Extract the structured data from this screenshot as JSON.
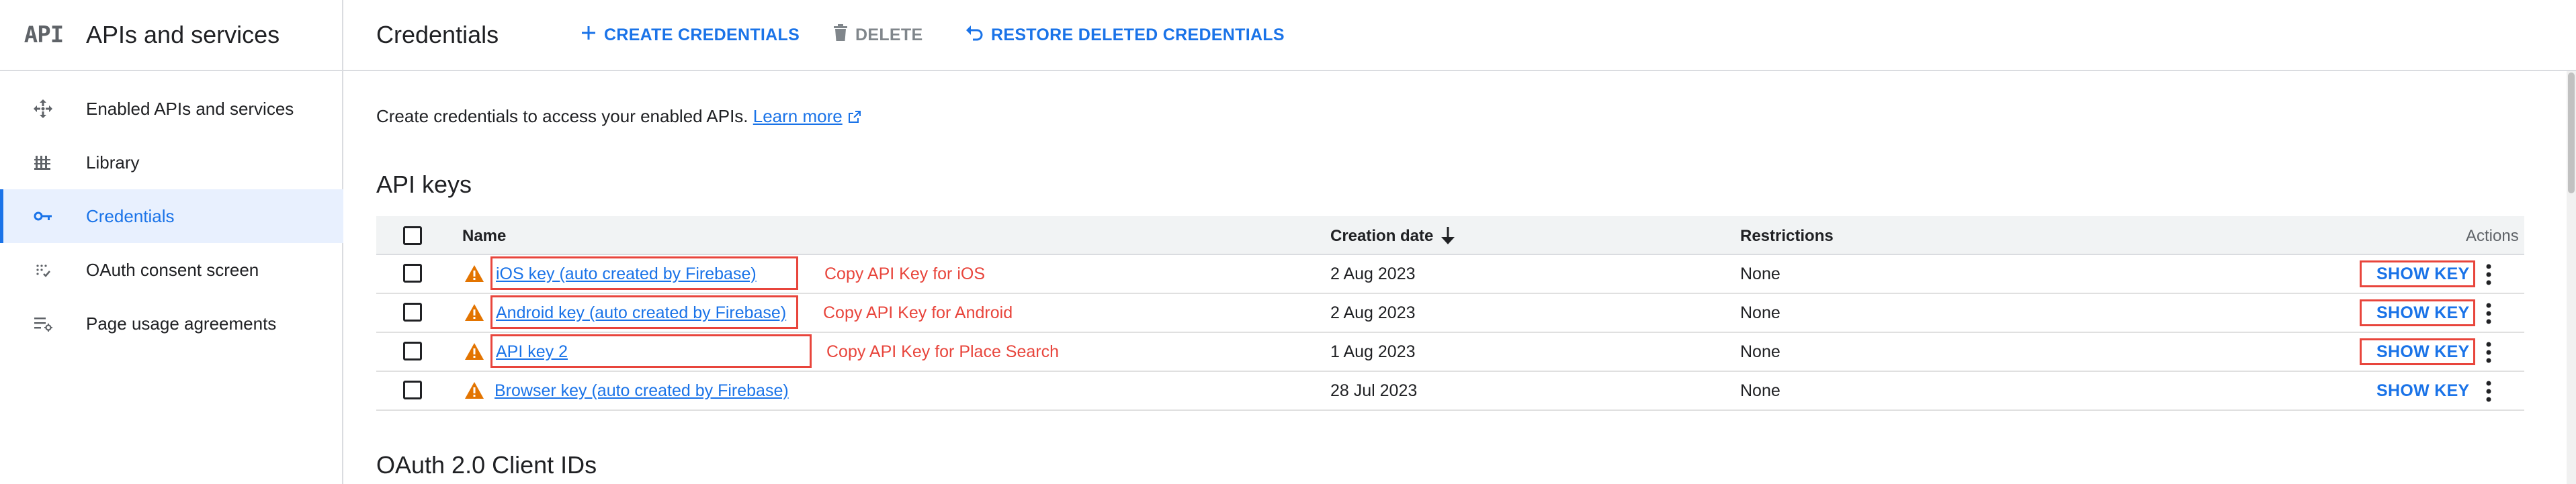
{
  "sidebar": {
    "logo": "API",
    "title": "APIs and services",
    "items": [
      {
        "label": "Enabled APIs and services",
        "icon": "services-icon"
      },
      {
        "label": "Library",
        "icon": "library-icon"
      },
      {
        "label": "Credentials",
        "icon": "key-icon",
        "active": true
      },
      {
        "label": "OAuth consent screen",
        "icon": "consent-icon"
      },
      {
        "label": "Page usage agreements",
        "icon": "settings-list-icon"
      }
    ]
  },
  "toolbar": {
    "title": "Credentials",
    "create_label": "CREATE CREDENTIALS",
    "delete_label": "DELETE",
    "restore_label": "RESTORE DELETED CREDENTIALS"
  },
  "intro": {
    "text": "Create credentials to access your enabled APIs.",
    "link": "Learn more"
  },
  "api_keys": {
    "heading": "API keys",
    "columns": {
      "name": "Name",
      "creation_date": "Creation date",
      "restrictions": "Restrictions",
      "actions": "Actions"
    },
    "rows": [
      {
        "name": "iOS key (auto created by Firebase)",
        "note": "Copy API Key for iOS",
        "date": "2 Aug 2023",
        "restrictions": "None",
        "action": "SHOW KEY"
      },
      {
        "name": "Android key (auto created by Firebase)",
        "note": "Copy API Key for Android",
        "date": "2 Aug 2023",
        "restrictions": "None",
        "action": "SHOW KEY"
      },
      {
        "name": "API key 2",
        "note": "Copy API Key for Place Search",
        "date": "1 Aug 2023",
        "restrictions": "None",
        "action": "SHOW KEY"
      },
      {
        "name": "Browser key (auto created by Firebase)",
        "date": "28 Jul 2023",
        "restrictions": "None",
        "action": "SHOW KEY"
      }
    ]
  },
  "oauth": {
    "heading": "OAuth 2.0 Client IDs"
  },
  "colors": {
    "accent": "#1a73e8",
    "warning": "#e37400",
    "annotation": "#e8453c",
    "active_bg": "#e8f0fe"
  }
}
